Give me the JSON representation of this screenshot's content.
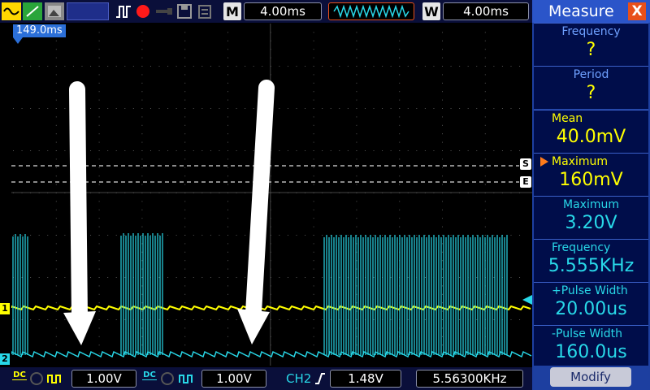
{
  "toolbar": {
    "m_label": "M",
    "m_timebase": "4.00ms",
    "w_label": "W",
    "w_timebase": "4.00ms"
  },
  "screen": {
    "trigger_position": "149.0ms",
    "cursor_s": "S",
    "cursor_e": "E",
    "ch1_marker": "1",
    "ch2_marker": "2"
  },
  "measure": {
    "title": "Measure",
    "close": "X",
    "items": [
      {
        "label": "Frequency",
        "value": "?",
        "color": "#ffff00"
      },
      {
        "label": "Period",
        "value": "?",
        "color": "#ffff00"
      },
      {
        "label": "Mean",
        "value": "40.0mV",
        "color": "#ffff00"
      },
      {
        "label": "Maximum",
        "value": "160mV",
        "color": "#ffff00"
      },
      {
        "label": "Maximum",
        "value": "3.20V",
        "color": "#28d8e8"
      },
      {
        "label": "Frequency",
        "value": "5.555KHz",
        "color": "#28d8e8"
      },
      {
        "label": "+Pulse Width",
        "value": "20.00us",
        "color": "#28d8e8"
      },
      {
        "label": "-Pulse Width",
        "value": "160.0us",
        "color": "#28d8e8"
      }
    ],
    "modify": "Modify"
  },
  "bottom": {
    "ch1_coupling": "DC",
    "ch1_scale": "1.00V",
    "ch2_coupling": "DC",
    "ch2_scale": "1.00V",
    "trigger_source": "CH2",
    "trigger_level": "1.48V",
    "frequency": "5.56300KHz"
  },
  "colors": {
    "ch1": "#ffff00",
    "ch2": "#28d8e8",
    "panel": "#1d3fa0"
  }
}
